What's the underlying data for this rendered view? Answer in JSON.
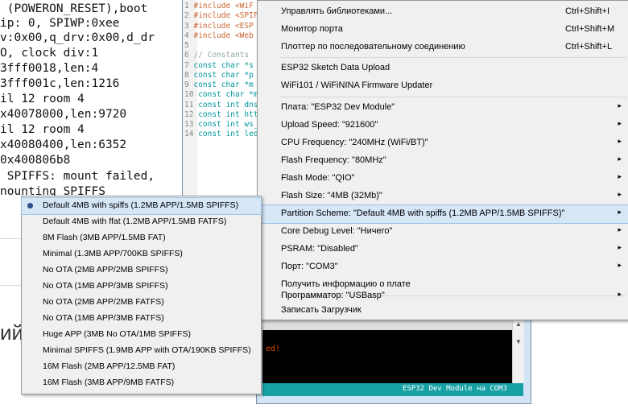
{
  "serial": {
    "lines": [
      " (POWERON_RESET),boot",
      "ip: 0, SPIWP:0xee",
      "v:0x00,q_drv:0x00,d_dr",
      "O, clock div:1",
      "3fff0018,len:4",
      "3fff001c,len:1216",
      "il 12 room 4",
      "x40078000,len:9720",
      "il 12 room 4",
      "x40080400,len:6352",
      "0x400806b8",
      " SPIFFS: mount failed,",
      "nounting SPIFFS"
    ]
  },
  "page_fragment": {
    "text": "ий"
  },
  "editor": {
    "lines": [
      {
        "n": "1",
        "a": "#include <WiF"
      },
      {
        "n": "2",
        "a": "#include <SPIF"
      },
      {
        "n": "3",
        "a": "#include <ESP"
      },
      {
        "n": "4",
        "a": "#include <Web"
      },
      {
        "n": "5",
        "a": ""
      },
      {
        "n": "6",
        "a": "// Constants"
      },
      {
        "n": "7",
        "a": "const char *s"
      },
      {
        "n": "8",
        "a": "const char *p"
      },
      {
        "n": "9",
        "a": "const char *m"
      },
      {
        "n": "10",
        "a": "const char *m"
      },
      {
        "n": "11",
        "a": "const int dns"
      },
      {
        "n": "12",
        "a": "const int htt"
      },
      {
        "n": "13",
        "a": "const int ws_"
      },
      {
        "n": "14",
        "a": "const int led"
      }
    ]
  },
  "console": {
    "message": "ed!"
  },
  "status_bar": {
    "board": "ESP32 Dev Module на COM3"
  },
  "tools_menu": {
    "items": [
      {
        "label": "Управлять библиотеками...",
        "shortcut": "Ctrl+Shift+I",
        "arrow": ""
      },
      {
        "label": "Монитор порта",
        "shortcut": "Ctrl+Shift+M",
        "arrow": ""
      },
      {
        "label": "Плоттер по последовательному соединению",
        "shortcut": "Ctrl+Shift+L",
        "arrow": ""
      },
      {
        "label": "ESP32 Sketch Data Upload",
        "shortcut": "",
        "arrow": ""
      },
      {
        "label": "WiFi101 / WiFiNINA Firmware Updater",
        "shortcut": "",
        "arrow": ""
      },
      {
        "label": "Плата: \"ESP32 Dev Module\"",
        "shortcut": "",
        "arrow": "▸"
      },
      {
        "label": "Upload Speed: \"921600\"",
        "shortcut": "",
        "arrow": "▸"
      },
      {
        "label": "CPU Frequency: \"240MHz (WiFi/BT)\"",
        "shortcut": "",
        "arrow": "▸"
      },
      {
        "label": "Flash Frequency: \"80MHz\"",
        "shortcut": "",
        "arrow": "▸"
      },
      {
        "label": "Flash Mode: \"QIO\"",
        "shortcut": "",
        "arrow": "▸"
      },
      {
        "label": "Flash Size: \"4MB (32Mb)\"",
        "shortcut": "",
        "arrow": "▸"
      },
      {
        "label": "Partition Scheme: \"Default 4MB with spiffs (1.2MB APP/1.5MB SPIFFS)\"",
        "shortcut": "",
        "arrow": "▸"
      },
      {
        "label": "Core Debug Level: \"Ничего\"",
        "shortcut": "",
        "arrow": "▸"
      },
      {
        "label": "PSRAM: \"Disabled\"",
        "shortcut": "",
        "arrow": "▸"
      },
      {
        "label": "Порт: \"COM3\"",
        "shortcut": "",
        "arrow": "▸"
      },
      {
        "label": "Получить информацию о плате",
        "shortcut": "",
        "arrow": ""
      },
      {
        "label": "Программатор: \"USBasp\"",
        "shortcut": "",
        "arrow": "▸"
      },
      {
        "label": "Записать Загрузчик",
        "shortcut": "",
        "arrow": ""
      }
    ]
  },
  "partition_submenu": {
    "items": [
      "Default 4MB with spiffs (1.2MB APP/1.5MB SPIFFS)",
      "Default 4MB with ffat (1.2MB APP/1.5MB FATFS)",
      "8M Flash (3MB APP/1.5MB FAT)",
      "Minimal (1.3MB APP/700KB SPIFFS)",
      "No OTA (2MB APP/2MB SPIFFS)",
      "No OTA (1MB APP/3MB SPIFFS)",
      "No OTA (2MB APP/2MB FATFS)",
      "No OTA (1MB APP/3MB FATFS)",
      "Huge APP (3MB No OTA/1MB SPIFFS)",
      "Minimal SPIFFS (1.9MB APP with OTA/190KB SPIFFS)",
      "16M Flash (2MB APP/12.5MB FAT)",
      "16M Flash (3MB APP/9MB FATFS)"
    ]
  }
}
